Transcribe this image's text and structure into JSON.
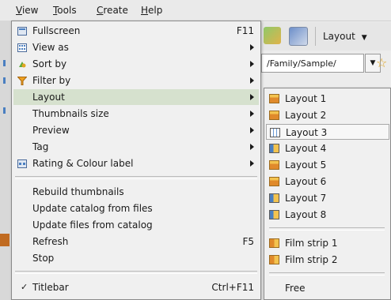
{
  "menubar": {
    "items": [
      "View",
      "Tools",
      "Create",
      "Help"
    ]
  },
  "toolbar": {
    "layout_label": "Layout",
    "path_value": "/Family/Sample/"
  },
  "main_menu": {
    "items": [
      {
        "label": "Fullscreen",
        "shortcut": "F11",
        "icon": "fullscreen-icon"
      },
      {
        "label": "View as",
        "submenu": true,
        "icon": "view-as-icon"
      },
      {
        "label": "Sort by",
        "submenu": true,
        "icon": "sort-icon"
      },
      {
        "label": "Filter by",
        "submenu": true,
        "icon": "filter-icon"
      },
      {
        "label": "Layout",
        "submenu": true,
        "highlight": true
      },
      {
        "label": "Thumbnails size",
        "submenu": true
      },
      {
        "label": "Preview",
        "submenu": true
      },
      {
        "label": "Tag",
        "submenu": true
      },
      {
        "label": "Rating & Colour label",
        "submenu": true,
        "icon": "rating-icon"
      },
      {
        "label": "Rebuild thumbnails"
      },
      {
        "label": "Update catalog from files"
      },
      {
        "label": "Update files from catalog"
      },
      {
        "label": "Refresh",
        "shortcut": "F5"
      },
      {
        "label": "Stop"
      },
      {
        "label": "Titlebar",
        "shortcut": "Ctrl+F11",
        "checked": true
      }
    ]
  },
  "layout_submenu": {
    "items": [
      {
        "label": "Layout 1"
      },
      {
        "label": "Layout 2"
      },
      {
        "label": "Layout 3",
        "current": true
      },
      {
        "label": "Layout 4"
      },
      {
        "label": "Layout 5"
      },
      {
        "label": "Layout 6"
      },
      {
        "label": "Layout 7"
      },
      {
        "label": "Layout 8"
      },
      {
        "label": "Film strip 1"
      },
      {
        "label": "Film strip 2"
      },
      {
        "label": "Free"
      }
    ]
  },
  "colors": {
    "highlight": "#d6e1ce",
    "menu_bg": "#f0f0f0",
    "accent_orange": "#e08a2b"
  }
}
